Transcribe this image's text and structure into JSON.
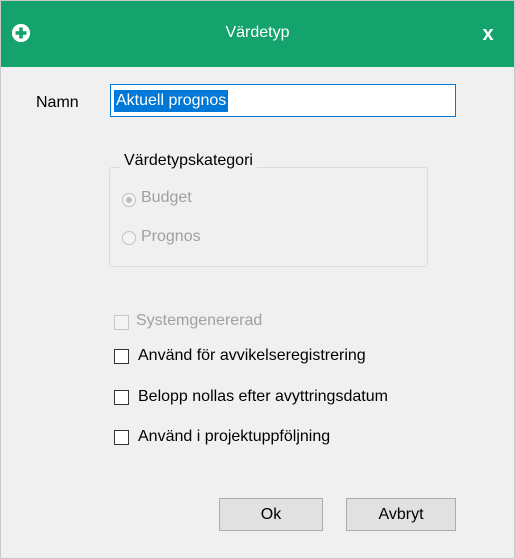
{
  "window": {
    "title": "Värdetyp",
    "close_label": "x",
    "app_icon": "plus-circle-icon",
    "accent": "#15a36d"
  },
  "form": {
    "name_label": "Namn",
    "name_value": "Aktuell prognos"
  },
  "category": {
    "legend": "Värdetypskategori",
    "options": [
      {
        "label": "Budget",
        "selected": true,
        "enabled": false
      },
      {
        "label": "Prognos",
        "selected": false,
        "enabled": false
      }
    ]
  },
  "checkboxes": [
    {
      "label": "Systemgenererad",
      "checked": false,
      "enabled": false
    },
    {
      "label": "Använd för avvikelseregistrering",
      "checked": false,
      "enabled": true
    },
    {
      "label": "Belopp nollas efter avyttringsdatum",
      "checked": false,
      "enabled": true
    },
    {
      "label": "Använd i projektuppföljning",
      "checked": false,
      "enabled": true
    }
  ],
  "buttons": {
    "ok": "Ok",
    "cancel": "Avbryt"
  }
}
